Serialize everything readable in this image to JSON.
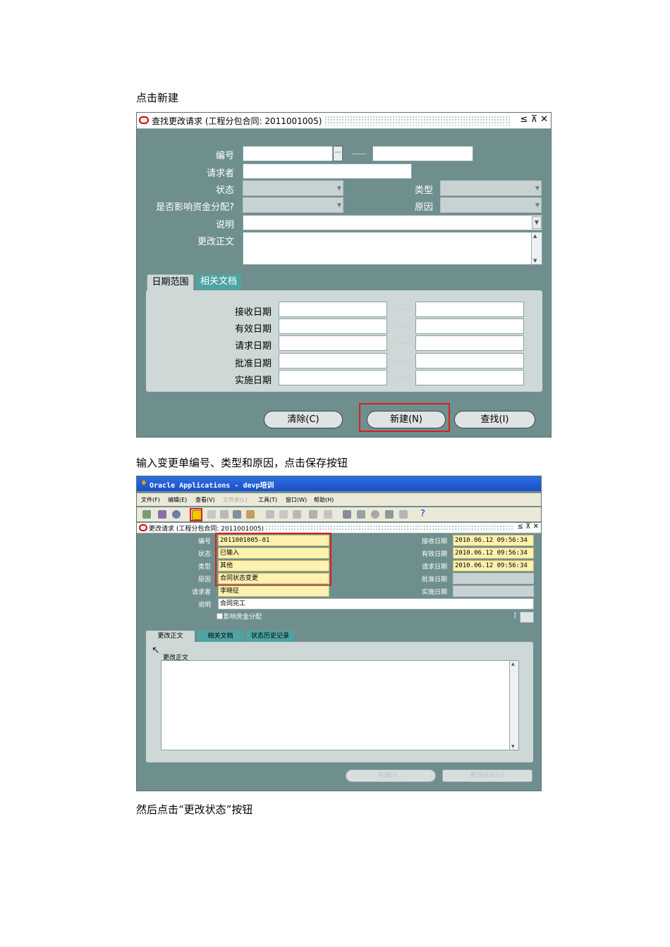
{
  "captions": {
    "c1": "点击新建",
    "c2": "输入变更单编号、类型和原因，点击保存按钮",
    "c3": "然后点击“更改状态”按钮"
  },
  "find_window": {
    "title": "查找更改请求 (工程分包合同: 2011001005)",
    "controls": "≤ ⊼ ✕",
    "labels": {
      "number": "编号",
      "requester": "请求者",
      "status": "状态",
      "type": "类型",
      "affects_funding": "是否影响资金分配?",
      "reason": "原因",
      "description": "说明",
      "change_text": "更改正文"
    },
    "lov_button": "···",
    "tabs": [
      "日期范围",
      "相关文档"
    ],
    "date_labels": [
      "接收日期",
      "有效日期",
      "请求日期",
      "批准日期",
      "实施日期"
    ],
    "buttons": {
      "clear": "清除(C)",
      "new": "新建(N)",
      "find": "查找(I)"
    }
  },
  "app_window": {
    "app_title": "Oracle Applications - devp培训",
    "menu": [
      "文件(F)",
      "编辑(E)",
      "查看(V)",
      "文件夹(L)",
      "工具(T)",
      "窗口(W)",
      "帮助(H)"
    ],
    "form_title": "更改请求 (工程分包合同: 2011001005)",
    "controls": "≤ ⊼ ✕",
    "labels": {
      "number": "编号",
      "status": "状态",
      "type": "类型",
      "reason": "原因",
      "requester": "请求者",
      "description": "说明",
      "received": "接收日期",
      "effective": "有效日期",
      "requested": "请求日期",
      "approved": "批准日期",
      "implemented": "实施日期",
      "affects_funding": "影响资金分配"
    },
    "values": {
      "number": "2011001005-01",
      "status": "已输入",
      "type": "其他",
      "reason": "合同状态变更",
      "requester": "李晓征",
      "description": "合同完工",
      "received": "2010.06.12 09:56:34",
      "effective": "2010.06.12 09:56:34",
      "requested": "2010.06.12 09:56:34"
    },
    "flex_bracket": "[",
    "tabs": [
      "更改正文",
      "相关文档",
      "状态历史记录"
    ],
    "change_text_label": "更改正文",
    "buttons": {
      "implement": "实施(I)...",
      "change_status": "更改状态(C)"
    },
    "help_icon": "?"
  }
}
